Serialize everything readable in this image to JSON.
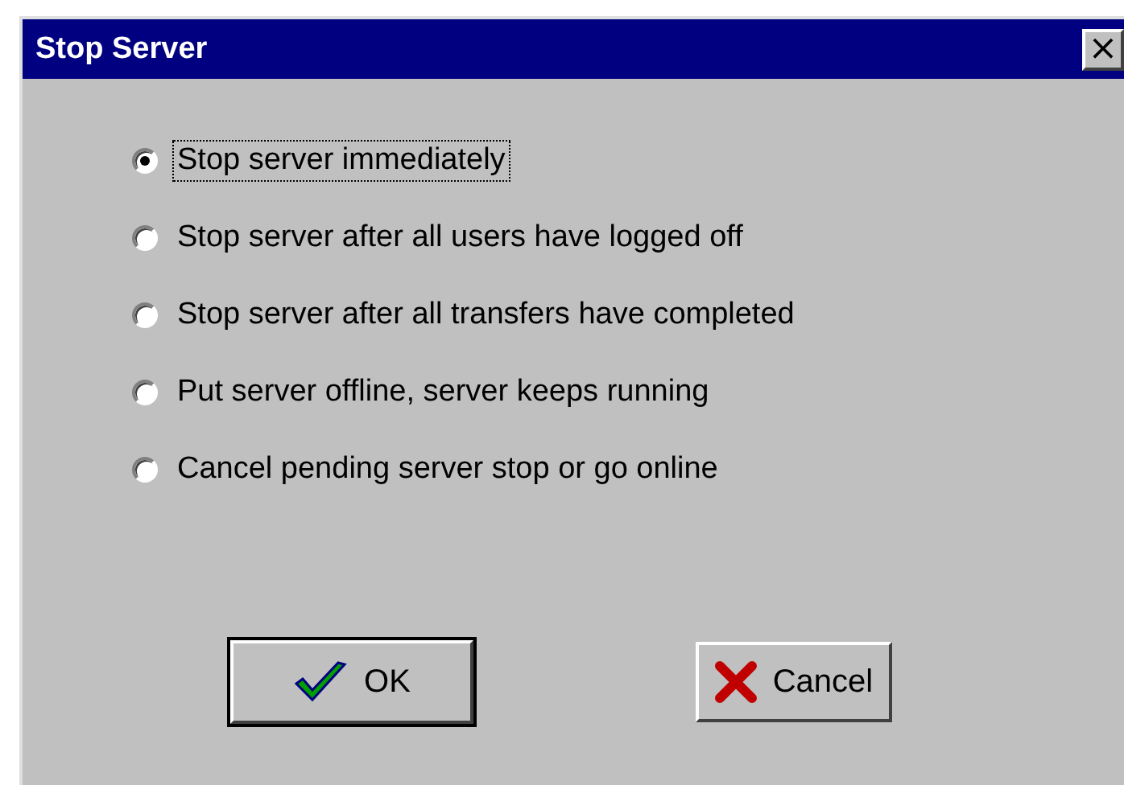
{
  "window": {
    "title": "Stop Server",
    "close_button": "×"
  },
  "options": [
    {
      "label": "Stop server immediately",
      "selected": true,
      "focused": true
    },
    {
      "label": "Stop server after all users have logged off",
      "selected": false,
      "focused": false
    },
    {
      "label": "Stop server after all transfers have completed",
      "selected": false,
      "focused": false
    },
    {
      "label": "Put server offline, server keeps running",
      "selected": false,
      "focused": false
    },
    {
      "label": "Cancel pending server stop or go online",
      "selected": false,
      "focused": false
    }
  ],
  "buttons": [
    {
      "label": "OK",
      "kind": "ok",
      "default": true
    },
    {
      "label": "Cancel",
      "kind": "cancel",
      "default": false
    }
  ]
}
